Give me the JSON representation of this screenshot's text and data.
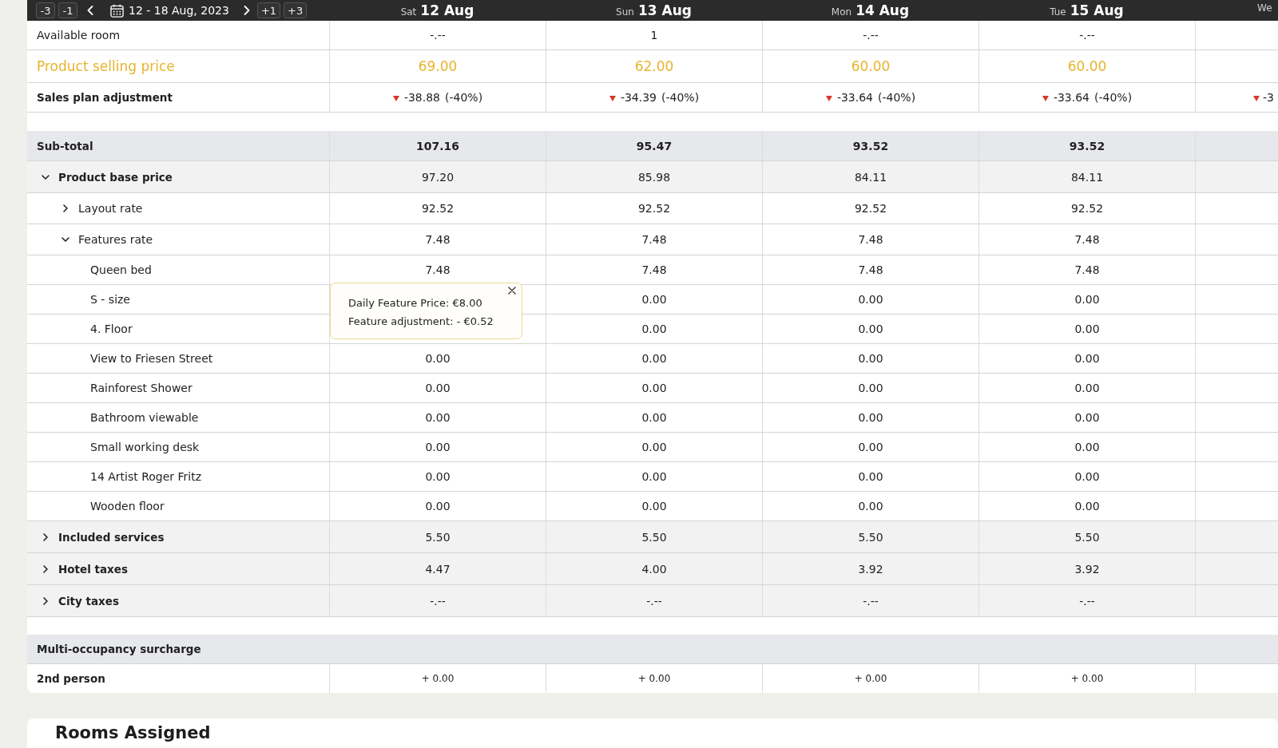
{
  "toolbar": {
    "back_steps": [
      "-3",
      "-1"
    ],
    "date_range": "12 - 18 Aug, 2023",
    "forward_steps": [
      "+1",
      "+3"
    ]
  },
  "days": [
    {
      "weekday": "Sat",
      "date": "12 Aug"
    },
    {
      "weekday": "Sun",
      "date": "13 Aug"
    },
    {
      "weekday": "Mon",
      "date": "14 Aug"
    },
    {
      "weekday": "Tue",
      "date": "15 Aug"
    },
    {
      "weekday": "We"
    }
  ],
  "price_table": {
    "top_rows": [
      {
        "kind": "info",
        "label": "Available room",
        "values": [
          "-.--",
          "1",
          "-.--",
          "-.--"
        ]
      },
      {
        "kind": "selling_price",
        "label": "Product selling price",
        "values": [
          "69.00",
          "62.00",
          "60.00",
          "60.00"
        ]
      },
      {
        "kind": "adjustment",
        "label": "Sales plan adjustment",
        "values": [
          {
            "amount": "-38.88",
            "percent": "(-40%)"
          },
          {
            "amount": "-34.39",
            "percent": "(-40%)"
          },
          {
            "amount": "-33.64",
            "percent": "(-40%)"
          },
          {
            "amount": "-33.64",
            "percent": "(-40%)"
          },
          {
            "amount": "-3"
          }
        ]
      }
    ],
    "subtotal": {
      "label": "Sub-total",
      "values": [
        "107.16",
        "95.47",
        "93.52",
        "93.52"
      ]
    },
    "breakdown": [
      {
        "label": "Product base price",
        "values": [
          "97.20",
          "85.98",
          "84.11",
          "84.11"
        ],
        "expanded": true,
        "children": [
          {
            "label": "Layout rate",
            "values": [
              "92.52",
              "92.52",
              "92.52",
              "92.52"
            ],
            "expanded": false
          },
          {
            "label": "Features rate",
            "values": [
              "7.48",
              "7.48",
              "7.48",
              "7.48"
            ],
            "expanded": true,
            "children": [
              {
                "label": "Queen bed",
                "values": [
                  "7.48",
                  "7.48",
                  "7.48",
                  "7.48"
                ]
              },
              {
                "label": "S - size",
                "values": [
                  "0.00",
                  "0.00",
                  "0.00"
                ]
              },
              {
                "label": "4. Floor",
                "values": [
                  "0.00",
                  "0.00",
                  "0.00"
                ]
              },
              {
                "label": "View to Friesen Street",
                "values": [
                  "0.00",
                  "0.00",
                  "0.00",
                  "0.00"
                ]
              },
              {
                "label": "Rainforest Shower",
                "values": [
                  "0.00",
                  "0.00",
                  "0.00",
                  "0.00"
                ]
              },
              {
                "label": "Bathroom viewable",
                "values": [
                  "0.00",
                  "0.00",
                  "0.00",
                  "0.00"
                ]
              },
              {
                "label": "Small working desk",
                "values": [
                  "0.00",
                  "0.00",
                  "0.00",
                  "0.00"
                ]
              },
              {
                "label": "14 Artist Roger Fritz",
                "values": [
                  "0.00",
                  "0.00",
                  "0.00",
                  "0.00"
                ]
              },
              {
                "label": "Wooden floor",
                "values": [
                  "0.00",
                  "0.00",
                  "0.00",
                  "0.00"
                ]
              }
            ]
          }
        ]
      },
      {
        "label": "Included services",
        "values": [
          "5.50",
          "5.50",
          "5.50",
          "5.50"
        ],
        "expanded": false
      },
      {
        "label": "Hotel taxes",
        "values": [
          "4.47",
          "4.00",
          "3.92",
          "3.92"
        ],
        "expanded": false
      },
      {
        "label": "City taxes",
        "values": [
          "-.--",
          "-.--",
          "-.--",
          "-.--"
        ],
        "expanded": false
      }
    ],
    "tooltip": {
      "lines": [
        "Daily Feature Price: €8.00",
        "Feature adjustment: - €0.52"
      ]
    },
    "multi_occupancy": {
      "title": "Multi-occupancy surcharge",
      "rows": [
        {
          "label": "2nd person",
          "values": [
            "+ 0.00",
            "+ 0.00",
            "+ 0.00",
            "+ 0.00"
          ]
        }
      ]
    }
  },
  "rooms_assigned": {
    "title": "Rooms Assigned"
  }
}
